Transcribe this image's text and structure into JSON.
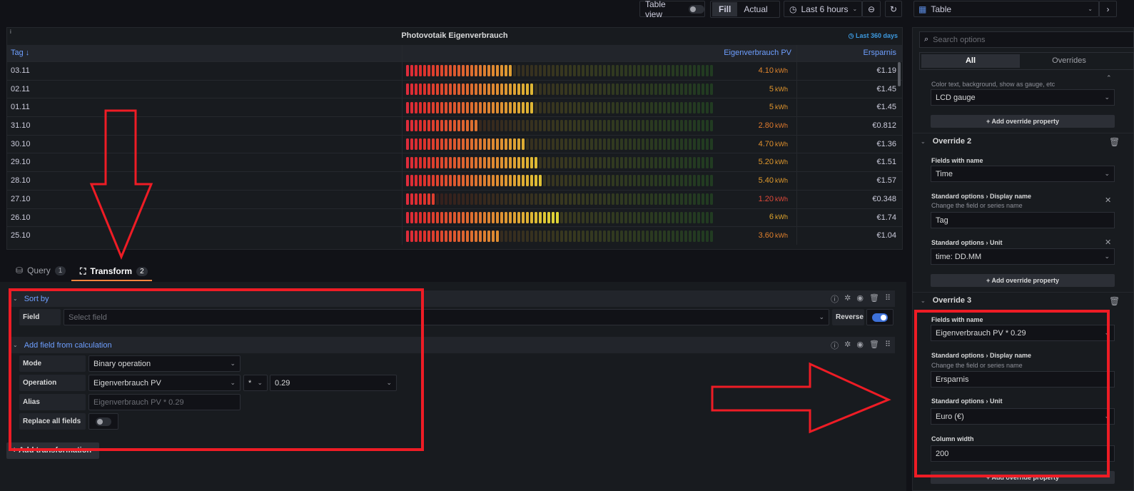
{
  "toolbar": {
    "table_view": "Table view",
    "fill": "Fill",
    "actual": "Actual",
    "time_range": "Last 6 hours"
  },
  "viz_picker": {
    "label": "Table"
  },
  "panel": {
    "title": "Photovotaik Eigenverbrauch",
    "time_override": "Last 360 days",
    "info": "i",
    "columns": [
      "Tag ↓",
      "Eigenverbrauch PV",
      "Ersparnis"
    ],
    "gauge_max": 12,
    "rows": [
      {
        "tag": "03.11",
        "value": 4.1,
        "display": "4.10",
        "unit": "kWh",
        "value_color": "#e0852d",
        "savings": "€1.19"
      },
      {
        "tag": "02.11",
        "value": 5,
        "display": "5",
        "unit": "kWh",
        "value_color": "#e0952d",
        "savings": "€1.45"
      },
      {
        "tag": "01.11",
        "value": 5,
        "display": "5",
        "unit": "kWh",
        "value_color": "#e0952d",
        "savings": "€1.45"
      },
      {
        "tag": "31.10",
        "value": 2.8,
        "display": "2.80",
        "unit": "kWh",
        "value_color": "#e07a2d",
        "savings": "€0.812"
      },
      {
        "tag": "30.10",
        "value": 4.7,
        "display": "4.70",
        "unit": "kWh",
        "value_color": "#e0902d",
        "savings": "€1.36"
      },
      {
        "tag": "29.10",
        "value": 5.2,
        "display": "5.20",
        "unit": "kWh",
        "value_color": "#e0982d",
        "savings": "€1.51"
      },
      {
        "tag": "28.10",
        "value": 5.4,
        "display": "5.40",
        "unit": "kWh",
        "value_color": "#e09a2d",
        "savings": "€1.57"
      },
      {
        "tag": "27.10",
        "value": 1.2,
        "display": "1.20",
        "unit": "kWh",
        "value_color": "#e04a3a",
        "savings": "€0.348"
      },
      {
        "tag": "26.10",
        "value": 6,
        "display": "6",
        "unit": "kWh",
        "value_color": "#e0a52d",
        "savings": "€1.74"
      },
      {
        "tag": "25.10",
        "value": 3.6,
        "display": "3.60",
        "unit": "kWh",
        "value_color": "#e0802d",
        "savings": "€1.04"
      }
    ]
  },
  "tabs": [
    {
      "label": "Query",
      "count": "1"
    },
    {
      "label": "Transform",
      "count": "2"
    }
  ],
  "sort_by": {
    "title": "Sort by",
    "field_label": "Field",
    "field_placeholder": "Select field",
    "reverse_label": "Reverse",
    "reverse": true
  },
  "calc": {
    "title": "Add field from calculation",
    "mode_label": "Mode",
    "mode": "Binary operation",
    "operation_label": "Operation",
    "left": "Eigenverbrauch PV",
    "operator": "*",
    "right": "0.29",
    "alias_label": "Alias",
    "alias_placeholder": "Eigenverbrauch PV * 0.29",
    "replace_label": "Replace all fields",
    "replace": false
  },
  "add_transformation": "+ Add transformation",
  "options": {
    "search_placeholder": "Search options",
    "tab_all": "All",
    "tab_overrides": "Overrides",
    "cell_desc": "Color text, background, show as gauge, etc",
    "cell_value": "LCD gauge",
    "add_prop": "+ Add override property",
    "override2": {
      "title": "Override 2",
      "fields_label": "Fields with name",
      "fields": "Time",
      "dn_label": "Standard options  ›  Display name",
      "dn_desc": "Change the field or series name",
      "dn": "Tag",
      "unit_label": "Standard options  ›  Unit",
      "unit": "time: DD.MM"
    },
    "override3": {
      "title": "Override 3",
      "fields_label": "Fields with name",
      "fields": "Eigenverbrauch PV * 0.29",
      "dn_label": "Standard options  ›  Display name",
      "dn_desc": "Change the field or series name",
      "dn": "Ersparnis",
      "unit_label": "Standard options  ›  Unit",
      "unit": "Euro (€)",
      "cw_label": "Column width",
      "cw": "200"
    }
  }
}
